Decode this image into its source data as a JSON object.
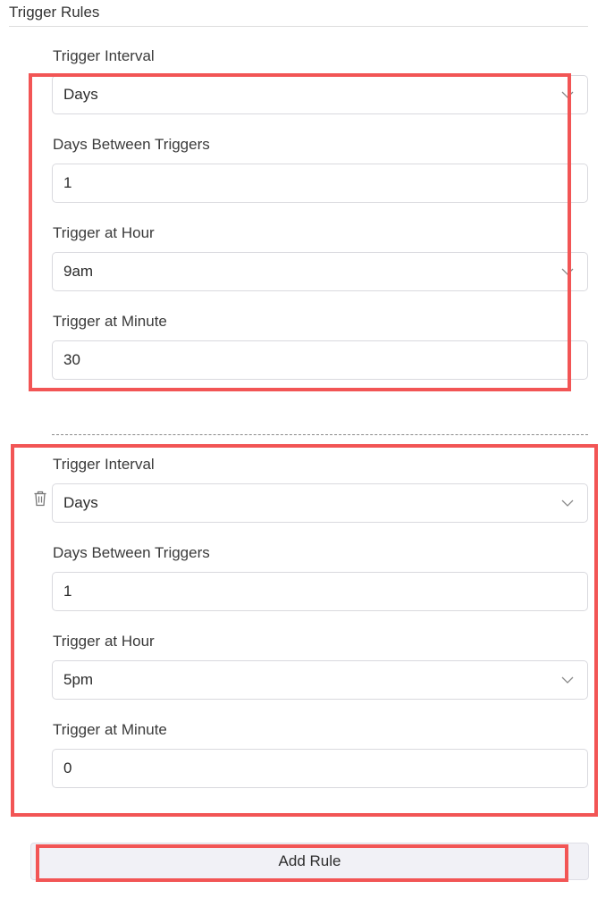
{
  "section": {
    "title": "Trigger Rules"
  },
  "rules": [
    {
      "interval_label": "Trigger Interval",
      "interval_value": "Days",
      "days_label": "Days Between Triggers",
      "days_value": "1",
      "hour_label": "Trigger at Hour",
      "hour_value": "9am",
      "minute_label": "Trigger at Minute",
      "minute_value": "30"
    },
    {
      "interval_label": "Trigger Interval",
      "interval_value": "Days",
      "days_label": "Days Between Triggers",
      "days_value": "1",
      "hour_label": "Trigger at Hour",
      "hour_value": "5pm",
      "minute_label": "Trigger at Minute",
      "minute_value": "0"
    }
  ],
  "actions": {
    "add_rule_label": "Add Rule"
  },
  "icons": {
    "chevron": "chevron-down-icon",
    "delete": "trash-icon"
  },
  "colors": {
    "highlight": "#f25555",
    "button_bg": "#f1f1f6",
    "field_border": "#d9d9de"
  }
}
